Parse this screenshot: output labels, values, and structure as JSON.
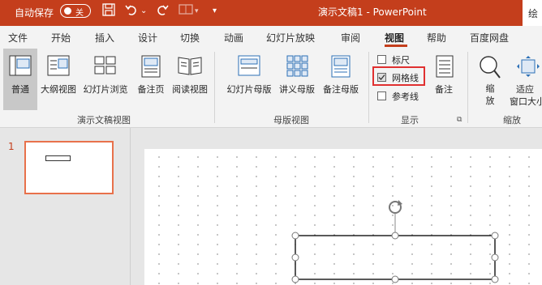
{
  "titlebar": {
    "autosave_label": "自动保存",
    "autosave_state": "关",
    "doc_title": "演示文稿1  -  PowerPoint",
    "sign_label": "绘"
  },
  "tabs": [
    "文件",
    "开始",
    "插入",
    "设计",
    "切换",
    "动画",
    "幻灯片放映",
    "审阅",
    "视图",
    "帮助",
    "百度网盘"
  ],
  "active_tab": "视图",
  "ribbon": {
    "presentation_views": {
      "group_label": "演示文稿视图",
      "buttons": [
        "普通",
        "大纲视图",
        "幻灯片浏览",
        "备注页",
        "阅读视图"
      ]
    },
    "master_views": {
      "group_label": "母版视图",
      "buttons": [
        "幻灯片母版",
        "讲义母版",
        "备注母版"
      ]
    },
    "show": {
      "group_label": "显示",
      "checkboxes": [
        {
          "label": "标尺",
          "checked": false
        },
        {
          "label": "网格线",
          "checked": true
        },
        {
          "label": "参考线",
          "checked": false
        }
      ],
      "notes_button": "备注"
    },
    "zoom": {
      "group_label": "缩放",
      "zoom_button": "缩\n放",
      "fit_button_line1": "适应",
      "fit_button_line2": "窗口大小"
    }
  },
  "thumbnails": {
    "slide_number": "1"
  },
  "colors": {
    "accent": "#c43e1c",
    "thumb_border": "#e8714b",
    "highlight": "#e03030"
  }
}
